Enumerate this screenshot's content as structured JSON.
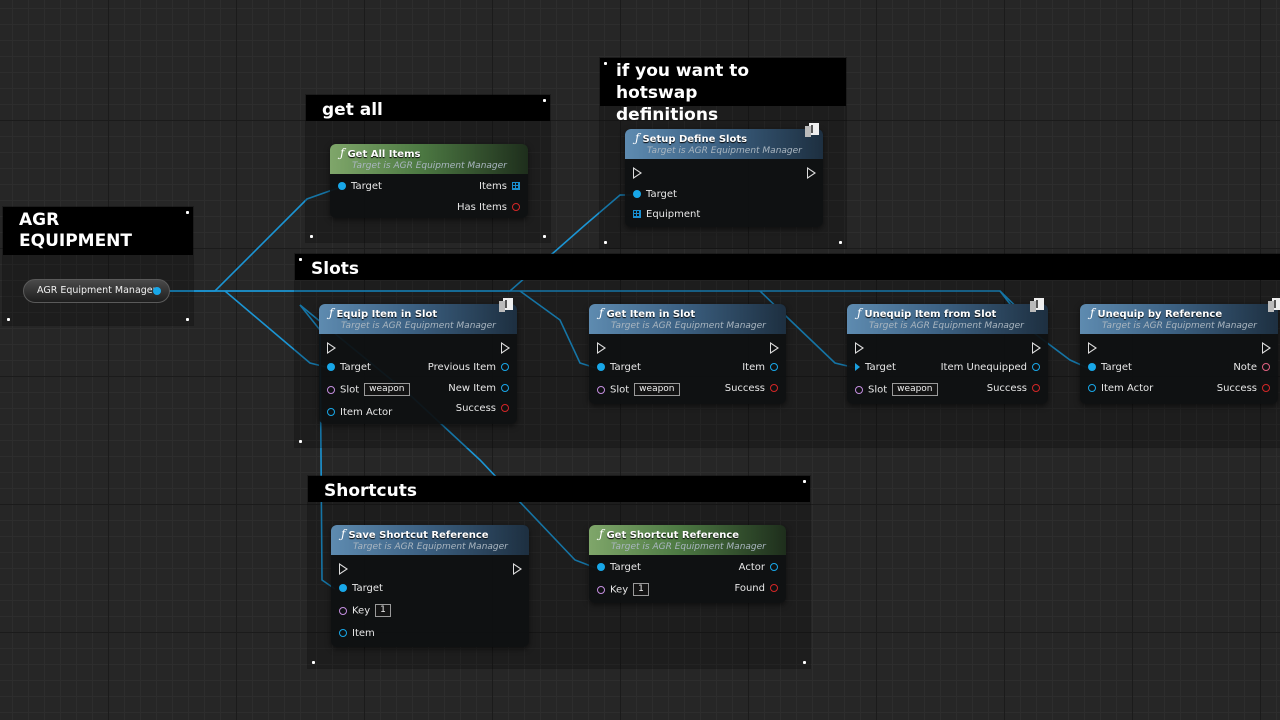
{
  "comments": {
    "agr": "AGR\nEQUIPMENT",
    "get_all": "get all",
    "hotswap": "if you want to hotswap\ndefinitions",
    "slots": "Slots",
    "shortcuts": "Shortcuts"
  },
  "variable": {
    "label": "AGR Equipment Manager"
  },
  "target_text": "Target is AGR Equipment Manager",
  "nodes": {
    "get_all_items": {
      "title": "Get All Items",
      "target": "Target",
      "items": "Items",
      "has_items": "Has Items"
    },
    "setup_define_slots": {
      "title": "Setup Define Slots",
      "target": "Target",
      "equipment": "Equipment"
    },
    "equip_item_in_slot": {
      "title": "Equip Item in Slot",
      "target": "Target",
      "slot": "Slot",
      "slot_value": "weapon",
      "item_actor": "Item Actor",
      "previous_item": "Previous Item",
      "new_item": "New Item",
      "success": "Success"
    },
    "get_item_in_slot": {
      "title": "Get Item in Slot",
      "target": "Target",
      "slot": "Slot",
      "slot_value": "weapon",
      "item": "Item",
      "success": "Success"
    },
    "unequip_item_from_slot": {
      "title": "Unequip Item from Slot",
      "target": "Target",
      "slot": "Slot",
      "slot_value": "weapon",
      "item_unequipped": "Item Unequipped",
      "success": "Success"
    },
    "unequip_by_reference": {
      "title": "Unequip by Reference",
      "target": "Target",
      "item_actor": "Item Actor",
      "note": "Note",
      "success": "Success"
    },
    "save_shortcut_reference": {
      "title": "Save Shortcut Reference",
      "target": "Target",
      "key": "Key",
      "key_value": "1",
      "item": "Item"
    },
    "get_shortcut_reference": {
      "title": "Get Shortcut Reference",
      "target": "Target",
      "key": "Key",
      "key_value": "1",
      "actor": "Actor",
      "found": "Found"
    }
  },
  "colors": {
    "object_pin": "#18a7e8",
    "string_pin": "#c48ee0",
    "bool_pin": "#d32626",
    "pure_header": "#4d7a43",
    "impure_header": "#3d6284"
  }
}
